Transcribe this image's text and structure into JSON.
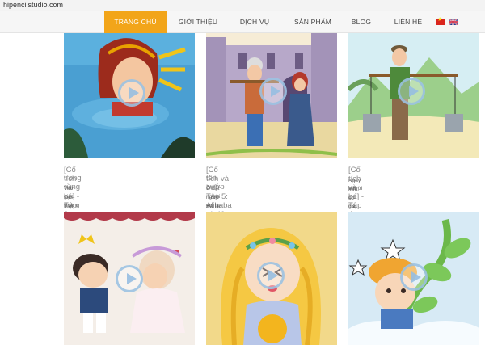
{
  "browser": {
    "url": "hipencilstudio.com"
  },
  "nav": {
    "items": [
      {
        "label": "TRANG CHỦ",
        "active": true
      },
      {
        "label": "GIỚI THIỆU"
      },
      {
        "label": "DỊCH VỤ"
      },
      {
        "label": "SẢN PHẨM"
      },
      {
        "label": "BLOG"
      },
      {
        "label": "LIÊN HỆ"
      }
    ],
    "languages": [
      "vn-flag-icon",
      "uk-flag-icon"
    ]
  },
  "colors": {
    "accent": "#f2a51a",
    "title": "#8a8a8a"
  },
  "cards": [
    {
      "title_line1": "[Cổ tích và bé] - Tập 6: Công chúa ngủ",
      "title_line2": "trong rừng",
      "desc_line1": "Thời hạn trăm năm đã hết, đến lúc công chúa Hồng Hoa tỉnh",
      "desc_line2": "giấc. Hoàng tử đi qua lâu đài..."
    },
    {
      "title_line1": "[Cổ tích và bé] - Tập 5: Alibaba và 40",
      "title_line2": "tên cướp",
      "desc_line1": "Ở đất nước Ba Tư có 2 anh em nhà nọ, người anh là Casim,",
      "desc_line2": "người em là Alibaba Này..."
    },
    {
      "title_line1": "[Cổ tích và bé] - Tập 4: Ăn khế trả vàng",
      "title_line2": "",
      "desc_line1": "Ngày xưa, có hai anh em trai, mẹ mất sớm, cùng sống với",
      "desc_line2": "người cha già. Sau khi họ lấp..."
    }
  ]
}
